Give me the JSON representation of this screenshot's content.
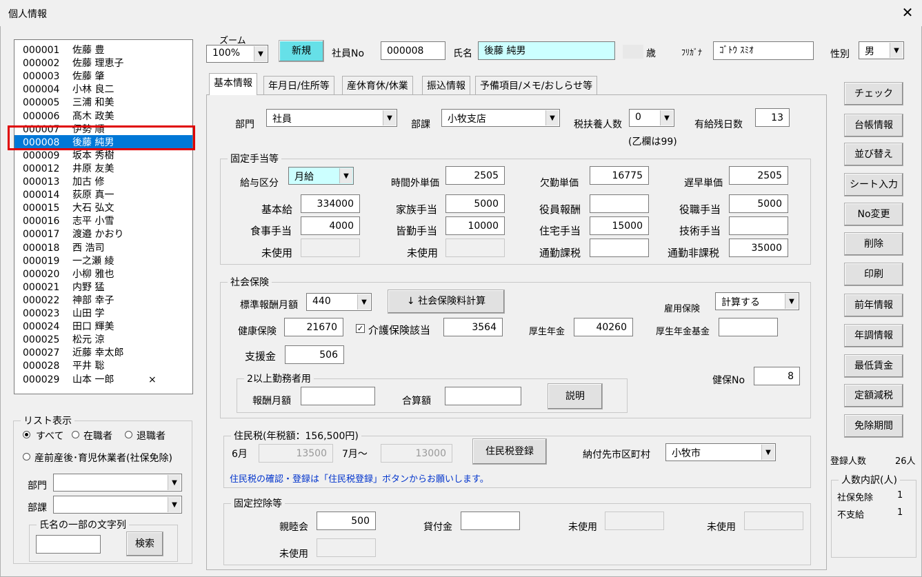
{
  "window": {
    "title": "個人情報",
    "close": "✕"
  },
  "employees": [
    {
      "id": "000001",
      "name": "佐藤 豊",
      "mark": ""
    },
    {
      "id": "000002",
      "name": "佐藤 理恵子",
      "mark": ""
    },
    {
      "id": "000003",
      "name": "佐藤 肇",
      "mark": ""
    },
    {
      "id": "000004",
      "name": "小林 良二",
      "mark": ""
    },
    {
      "id": "000005",
      "name": "三浦 和美",
      "mark": ""
    },
    {
      "id": "000006",
      "name": "髙木 政美",
      "mark": ""
    },
    {
      "id": "000007",
      "name": "伊勢 順",
      "mark": ""
    },
    {
      "id": "000008",
      "name": "後藤 純男",
      "mark": ""
    },
    {
      "id": "000009",
      "name": "坂本 秀樹",
      "mark": ""
    },
    {
      "id": "000012",
      "name": "井原 友美",
      "mark": ""
    },
    {
      "id": "000013",
      "name": "加古 修",
      "mark": ""
    },
    {
      "id": "000014",
      "name": "荻原 真一",
      "mark": ""
    },
    {
      "id": "000015",
      "name": "大石 弘文",
      "mark": ""
    },
    {
      "id": "000016",
      "name": "志平 小雪",
      "mark": ""
    },
    {
      "id": "000017",
      "name": "渡邉 かおり",
      "mark": ""
    },
    {
      "id": "000018",
      "name": "西 浩司",
      "mark": ""
    },
    {
      "id": "000019",
      "name": "一之瀬 綾",
      "mark": ""
    },
    {
      "id": "000020",
      "name": "小柳 雅也",
      "mark": ""
    },
    {
      "id": "000021",
      "name": "内野 猛",
      "mark": ""
    },
    {
      "id": "000022",
      "name": "神部 幸子",
      "mark": ""
    },
    {
      "id": "000023",
      "name": "山田 学",
      "mark": ""
    },
    {
      "id": "000024",
      "name": "田口 輝美",
      "mark": ""
    },
    {
      "id": "000025",
      "name": "松元 涼",
      "mark": ""
    },
    {
      "id": "000027",
      "name": "近藤 幸太郎",
      "mark": ""
    },
    {
      "id": "000028",
      "name": "平井 聡",
      "mark": ""
    },
    {
      "id": "000029",
      "name": "山本 一郎",
      "mark": "×"
    }
  ],
  "selected_index": 7,
  "list_filter": {
    "title": "リスト表示",
    "all": "すべて",
    "active": "在職者",
    "retired": "退職者",
    "leave": "産前産後･育児休業者(社保免除)",
    "dept_label": "部門",
    "section_label": "部課",
    "name_group": "氏名の一部の文字列",
    "search_button": "検索"
  },
  "header": {
    "zoom_label": "ズーム",
    "zoom_value": "100%",
    "new_button": "新規",
    "emp_no_label": "社員No",
    "emp_no": "000008",
    "name_label": "氏名",
    "name": "後藤 純男",
    "age_suffix": "歳",
    "kana_label": "ﾌﾘｶﾞﾅ",
    "kana": "ｺﾞﾄｳ ｽﾐｵ",
    "gender_label": "性別",
    "gender": "男"
  },
  "tabs": [
    "基本情報",
    "年月日/住所等",
    "産休育休/休業",
    "振込情報",
    "予備項目/メモ/おしらせ等"
  ],
  "basic": {
    "dept_label": "部門",
    "dept": "社員",
    "section_label": "部課",
    "section": "小牧支店",
    "dependents_label": "税扶養人数",
    "dependents": "0",
    "dependents_note": "(乙欄は99)",
    "paid_leave_label": "有給残日数",
    "paid_leave": "13"
  },
  "allowances": {
    "title": "固定手当等",
    "pay_type_label": "給与区分",
    "pay_type": "月給",
    "overtime_label": "時間外単価",
    "overtime": "2505",
    "absence_label": "欠勤単価",
    "absence": "16775",
    "late_label": "遅早単価",
    "late": "2505",
    "base_label": "基本給",
    "base": "334000",
    "family_label": "家族手当",
    "family": "5000",
    "officer_label": "役員報酬",
    "officer": "",
    "position_label": "役職手当",
    "position": "5000",
    "meal_label": "食事手当",
    "meal": "4000",
    "attendance_label": "皆勤手当",
    "attendance": "10000",
    "housing_label": "住宅手当",
    "housing": "15000",
    "skill_label": "技術手当",
    "skill": "",
    "unused1_label": "未使用",
    "unused2_label": "未使用",
    "commute_tax_label": "通勤課税",
    "commute_tax": "",
    "commute_free_label": "通勤非課税",
    "commute_free": "35000"
  },
  "insurance": {
    "title": "社会保険",
    "std_label": "標準報酬月額",
    "std": "440",
    "calc_button": "↓ 社会保険料計算",
    "employment_label": "雇用保険",
    "employment": "計算する",
    "health_label": "健康保険",
    "health": "21670",
    "care_label": "介護保険該当",
    "care": "3564",
    "pension_label": "厚生年金",
    "pension": "40260",
    "pension_fund_label": "厚生年金基金",
    "pension_fund": "",
    "support_label": "支援金",
    "support": "506",
    "multi_title": "2以上勤務者用",
    "monthly_label": "報酬月額",
    "monthly": "",
    "total_label": "合算額",
    "total": "",
    "explain_button": "説明",
    "kenpo_label": "健保No",
    "kenpo": "8"
  },
  "resident_tax": {
    "title": "住民税(年税額：156,500円)",
    "june_label": "6月",
    "june": "13500",
    "july_label": "7月～",
    "july": "13000",
    "register_button": "住民税登録",
    "city_label": "納付先市区町村",
    "city": "小牧市",
    "note": "住民税の確認・登録は「住民税登録」ボタンからお願いします。"
  },
  "deductions": {
    "title": "固定控除等",
    "social_label": "親睦会",
    "social": "500",
    "loan_label": "貸付金",
    "loan": "",
    "unused_label": "未使用"
  },
  "right_buttons": [
    "チェック",
    "台帳情報",
    "並び替え",
    "シート入力",
    "No変更",
    "削除",
    "印刷",
    "前年情報",
    "年調情報",
    "最低賃金",
    "定額減税",
    "免除期間"
  ],
  "summary": {
    "count_label": "登録人数",
    "count": "26人",
    "breakdown_title": "人数内訳(人)",
    "exempt_label": "社保免除",
    "exempt": "1",
    "unpaid_label": "不支給",
    "unpaid": "1"
  },
  "colors": {
    "highlight": "#0078d7",
    "name_bg": "#ccffff",
    "new_btn": "#66e0e8",
    "note_text": "#0033cc",
    "red_box": "#e00000"
  }
}
